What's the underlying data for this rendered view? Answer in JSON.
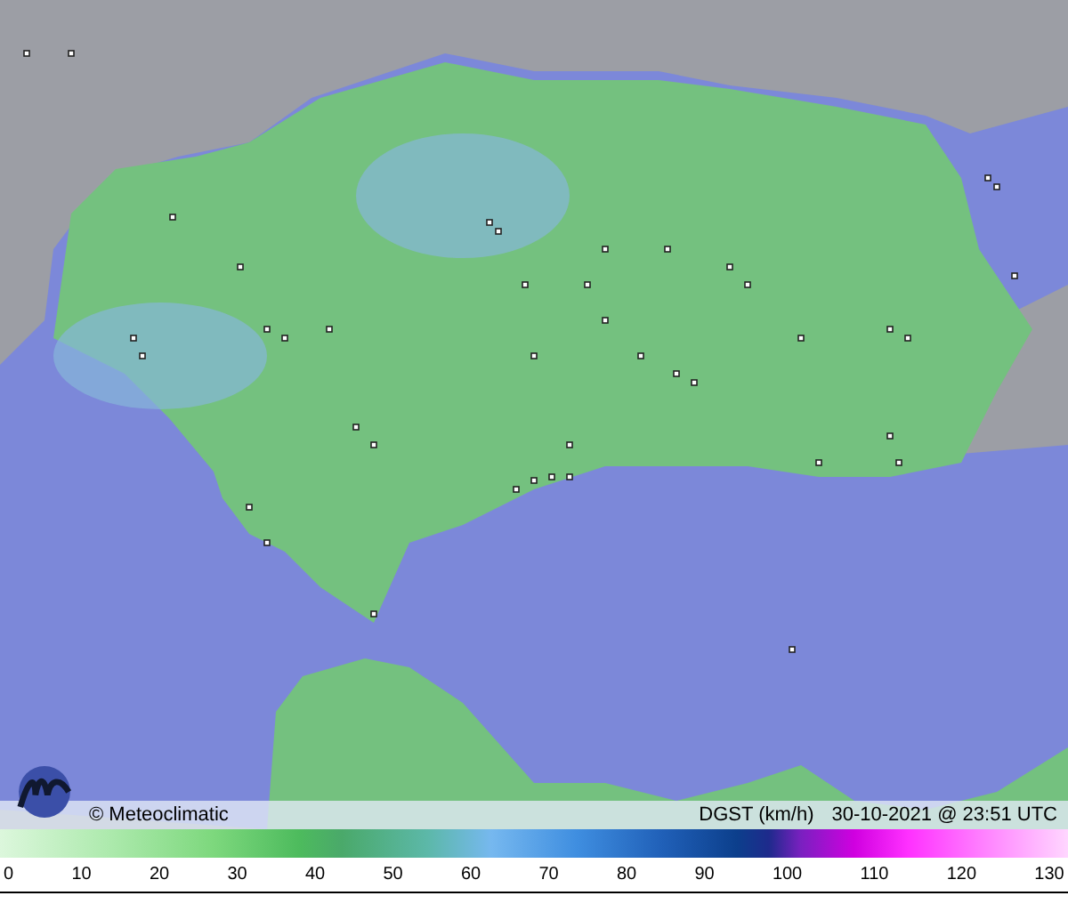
{
  "caption": {
    "credit": "© Meteoclimatic",
    "variable": "DGST (km/h)",
    "timestamp": "30-10-2021 @ 23:51 UTC"
  },
  "scale": {
    "labels": [
      "0",
      "10",
      "20",
      "30",
      "40",
      "50",
      "60",
      "70",
      "80",
      "90",
      "100",
      "110",
      "120",
      "130"
    ]
  }
}
